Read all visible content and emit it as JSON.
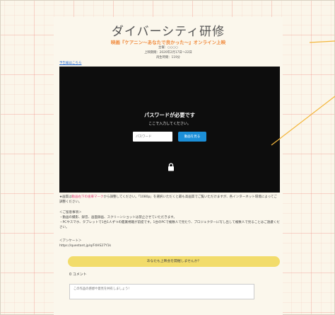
{
  "page": {
    "title": "ダイバーシティ研修",
    "subtitle": "映画『ケアニン〜あなたで良かった〜』オンライン上映",
    "meta": [
      "主催：○○○○",
      "上映期間：2020年2月17日〜22日",
      "再生時間：119分"
    ]
  },
  "links": {
    "top": "予告編はこちら"
  },
  "video": {
    "password_title": "パスワードが必要です",
    "password_sub": "ここで入力してください。",
    "password_placeholder": "パスワード",
    "watch_button": "動画を見る",
    "lock_icon": "lock-icon"
  },
  "notes": {
    "quality_prefix": "★画質は",
    "quality_highlight": "動画右下の歯車マーク",
    "quality_suffix": "から調整してください。「1080p」を選択いただくと最も高画質でご覧いただけますが、各インターネット環境によってご調整ください。",
    "cautions_heading": "＜ご留意事項＞",
    "cautions_line1": "・動画の撮影、録音、画面録画、スクリーンショットは禁止させていただきます。",
    "cautions_line2": "・PCやスマホ、タブレットで1台1人ずつの鑑賞視聴が前提です。1台のPCで複数人で見たり、プロジェクターに写し出して複数人で見ることはご遠慮ください。",
    "survey_heading": "＜アンケート＞",
    "survey_url": "https://questant.jp/q/F4HS27Y1k"
  },
  "cta": {
    "label": "あなたも上映会を開催しませんか？"
  },
  "comments": {
    "count_label": "0 コメント",
    "placeholder": "この作品の感想や意見を共有しましょう!"
  }
}
